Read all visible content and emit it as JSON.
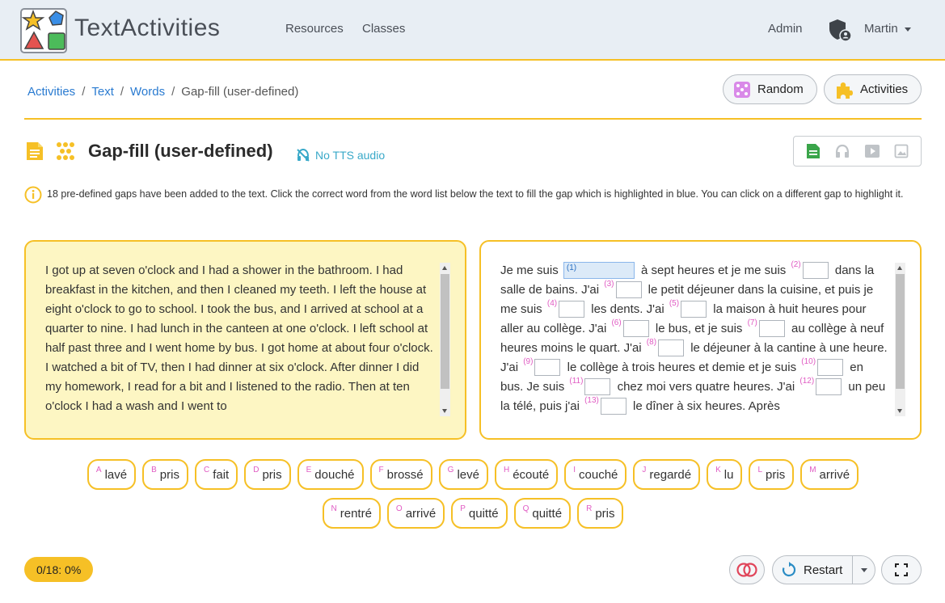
{
  "navbar": {
    "brand": "TextActivities",
    "links": {
      "resources": "Resources",
      "classes": "Classes",
      "admin": "Admin"
    },
    "user": "Martin"
  },
  "breadcrumb": {
    "items": [
      "Activities",
      "Text",
      "Words"
    ],
    "current": "Gap-fill (user-defined)",
    "separator": "/"
  },
  "actions": {
    "random": "Random",
    "activities": "Activities"
  },
  "title": "Gap-fill (user-defined)",
  "tts_note": "No TTS audio",
  "instructions": "18 pre-defined gaps have been added to the text. Click the correct word from the word list below the text to fill the gap which is highlighted in blue. You can click on a different gap to highlight it.",
  "source_text": "I got up at seven o'clock and I had a shower in the bathroom. I had breakfast in the kitchen, and then I cleaned my teeth. I left the house at eight o'clock to go to school. I took the bus, and I arrived at school at a quarter to nine. I had lunch in the canteen at one o'clock. I left school at half past three and I went home by bus. I got home at about four o'clock. I watched a bit of TV, then I had dinner at six o'clock. After dinner I did my homework, I read for a bit and I listened to the radio. Then at ten o'clock I had a wash and I went to",
  "gap_text": [
    {
      "t": "Je me suis "
    },
    {
      "gap": "(1)",
      "active": true
    },
    {
      "t": " à sept heures et je me suis "
    },
    {
      "gap": "(2)"
    },
    {
      "t": " dans la salle de bains. J'ai "
    },
    {
      "gap": "(3)"
    },
    {
      "t": " le petit déjeuner dans la cuisine, et puis je me suis "
    },
    {
      "gap": "(4)"
    },
    {
      "t": " les dents. J'ai "
    },
    {
      "gap": "(5)"
    },
    {
      "t": " la maison à huit heures pour aller au collège. J'ai "
    },
    {
      "gap": "(6)"
    },
    {
      "t": " le bus, et je suis "
    },
    {
      "gap": "(7)"
    },
    {
      "t": " au collège à neuf heures moins le quart. J'ai "
    },
    {
      "gap": "(8)"
    },
    {
      "t": " le déjeuner à la cantine à une heure. J'ai "
    },
    {
      "gap": "(9)"
    },
    {
      "t": " le collège à trois heures et demie et je suis "
    },
    {
      "gap": "(10)"
    },
    {
      "t": " en bus. Je suis "
    },
    {
      "gap": "(11)"
    },
    {
      "t": " chez moi vers quatre heures. J'ai "
    },
    {
      "gap": "(12)"
    },
    {
      "t": " un peu la télé, puis j'ai "
    },
    {
      "gap": "(13)"
    },
    {
      "t": " le dîner à six heures. Après"
    }
  ],
  "word_bank": {
    "row1": [
      {
        "letter": "A",
        "word": "lavé"
      },
      {
        "letter": "B",
        "word": "pris"
      },
      {
        "letter": "C",
        "word": "fait"
      },
      {
        "letter": "D",
        "word": "pris"
      },
      {
        "letter": "E",
        "word": "douché"
      },
      {
        "letter": "F",
        "word": "brossé"
      },
      {
        "letter": "G",
        "word": "levé"
      },
      {
        "letter": "H",
        "word": "écouté"
      },
      {
        "letter": "I",
        "word": "couché"
      },
      {
        "letter": "J",
        "word": "regardé"
      },
      {
        "letter": "K",
        "word": "lu"
      },
      {
        "letter": "L",
        "word": "pris"
      },
      {
        "letter": "M",
        "word": "arrivé"
      }
    ],
    "row2": [
      {
        "letter": "N",
        "word": "rentré"
      },
      {
        "letter": "O",
        "word": "arrivé"
      },
      {
        "letter": "P",
        "word": "quitté"
      },
      {
        "letter": "Q",
        "word": "quitté"
      },
      {
        "letter": "R",
        "word": "pris"
      }
    ]
  },
  "score": "0/18: 0%",
  "restart": "Restart",
  "colors": {
    "accent": "#f6c026",
    "link": "#2a7bd1",
    "gap_number": "#e05bc3",
    "tts": "#39a9c9"
  }
}
